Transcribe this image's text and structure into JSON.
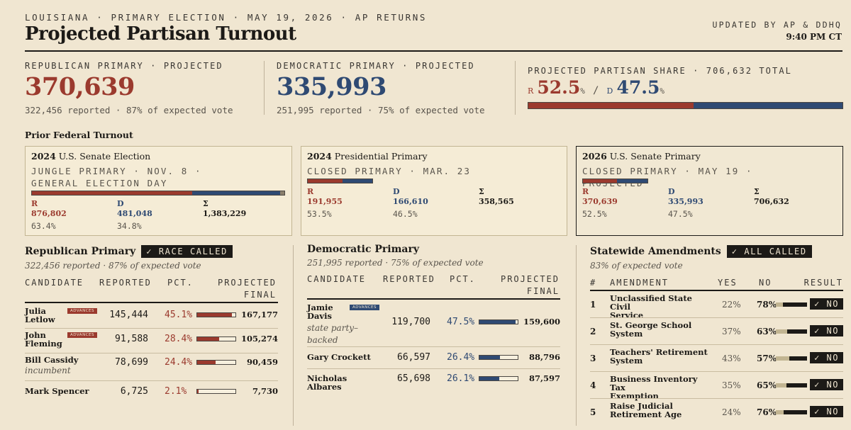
{
  "header": {
    "kicker": "LOUISIANA · PRIMARY ELECTION · MAY 19, 2026 · AP RETURNS",
    "title": "Projected Partisan Turnout",
    "updated_label": "UPDATED BY AP & DDHQ",
    "updated_time": "9:40 PM CT"
  },
  "totals": {
    "rep": {
      "label": "REPUBLICAN PRIMARY · PROJECTED",
      "value": "370,639",
      "sub": "322,456 reported · 87% of expected vote"
    },
    "dem": {
      "label": "DEMOCRATIC PRIMARY · PROJECTED",
      "value": "335,993",
      "sub": "251,995 reported · 75% of expected vote"
    },
    "share": {
      "label": "PROJECTED PARTISAN SHARE · 706,632 TOTAL",
      "r_letter": "R",
      "r_value": "52.5",
      "pct_sign": "%",
      "slash": "/",
      "d_letter": "D",
      "d_value": "47.5",
      "r_share": 52.5,
      "d_share": 47.5
    }
  },
  "colors": {
    "rep": "#9b3a2e",
    "dem": "#2f4a73",
    "other": "#8a7f6c",
    "bg": "#f0e6d1"
  },
  "prior": {
    "heading": "Prior Federal Turnout",
    "cards": [
      {
        "year": "2024",
        "name": "U.S. Senate Election",
        "sub": "JUNGLE PRIMARY · NOV. 8 · GENERAL ELECTION DAY",
        "r_val": "876,802",
        "d_val": "481,048",
        "t_val": "1,383,229",
        "r_pct": "63.4%",
        "d_pct": "34.8%",
        "r_share": 63.4,
        "d_share": 34.8,
        "o_share": 1.8
      },
      {
        "year": "2024",
        "name": "Presidential Primary",
        "sub": "CLOSED PRIMARY · MAR. 23",
        "r_val": "191,955",
        "d_val": "166,610",
        "t_val": "358,565",
        "r_pct": "53.5%",
        "d_pct": "46.5%",
        "r_share": 53.5,
        "d_share": 46.5,
        "o_share": 0
      },
      {
        "year": "2026",
        "name": "U.S. Senate Primary",
        "sub": "CLOSED PRIMARY · MAY 19 · PROJECTED",
        "r_val": "370,639",
        "d_val": "335,993",
        "t_val": "706,632",
        "r_pct": "52.5%",
        "d_pct": "47.5%",
        "r_share": 52.5,
        "d_share": 47.5,
        "o_share": 0
      }
    ],
    "r_label": "R",
    "d_label": "D",
    "t_label": "Σ"
  },
  "rep_primary": {
    "title": "Republican Primary",
    "badge": "✓ RACE CALLED",
    "sub": "322,456 reported · 87% of expected vote",
    "headers": {
      "candidate": "CANDIDATE",
      "reported": "REPORTED",
      "pct": "PCT.",
      "final_1": "PROJECTED",
      "final_2": "FINAL"
    },
    "rows": [
      {
        "name_1": "Julia",
        "name_2": "Letlow",
        "note": "",
        "advances": "ADVANCES",
        "reported": "145,444",
        "pct": "45.1%",
        "share": 45.1,
        "final": "167,177"
      },
      {
        "name_1": "John",
        "name_2": "Fleming",
        "note": "",
        "advances": "ADVANCES",
        "reported": "91,588",
        "pct": "28.4%",
        "share": 28.4,
        "final": "105,274"
      },
      {
        "name_1": "Bill Cassidy",
        "name_2": "",
        "note": "incumbent",
        "advances": "",
        "reported": "78,699",
        "pct": "24.4%",
        "share": 24.4,
        "final": "90,459"
      },
      {
        "name_1": "Mark Spencer",
        "name_2": "",
        "note": "",
        "advances": "",
        "reported": "6,725",
        "pct": "2.1%",
        "share": 2.1,
        "final": "7,730"
      }
    ]
  },
  "dem_primary": {
    "title": "Democratic Primary",
    "sub": "251,995 reported · 75% of expected vote",
    "headers": {
      "candidate": "CANDIDATE",
      "reported": "REPORTED",
      "pct": "PCT.",
      "final_1": "PROJECTED",
      "final_2": "FINAL"
    },
    "rows": [
      {
        "name_1": "Jamie",
        "name_2": "Davis",
        "note_1": "state party–",
        "note_2": "backed",
        "advances": "ADVANCES",
        "reported": "119,700",
        "pct": "47.5%",
        "share": 47.5,
        "final": "159,600"
      },
      {
        "name_1": "Gary Crockett",
        "name_2": "",
        "note_1": "",
        "note_2": "",
        "advances": "",
        "reported": "66,597",
        "pct": "26.4%",
        "share": 26.4,
        "final": "88,796"
      },
      {
        "name_1": "Nicholas Albares",
        "name_2": "",
        "note_1": "",
        "note_2": "",
        "advances": "",
        "reported": "65,698",
        "pct": "26.1%",
        "share": 26.1,
        "final": "87,597"
      }
    ]
  },
  "amendments": {
    "title": "Statewide Amendments",
    "badge": "✓ ALL CALLED",
    "sub": "83% of expected vote",
    "headers": {
      "num": "#",
      "name": "AMENDMENT",
      "yes": "YES",
      "no": "NO",
      "result": "RESULT"
    },
    "rows": [
      {
        "num": "1",
        "name_1": "Unclassified State Civil",
        "name_2": "Service",
        "yes": "22%",
        "no": "78%",
        "no_share": 78,
        "result": "✓ NO"
      },
      {
        "num": "2",
        "name_1": "St. George School",
        "name_2": "System",
        "yes": "37%",
        "no": "63%",
        "no_share": 63,
        "result": "✓ NO"
      },
      {
        "num": "3",
        "name_1": "Teachers' Retirement",
        "name_2": "System",
        "yes": "43%",
        "no": "57%",
        "no_share": 57,
        "result": "✓ NO"
      },
      {
        "num": "4",
        "name_1": "Business Inventory Tax",
        "name_2": "Exemption",
        "yes": "35%",
        "no": "65%",
        "no_share": 65,
        "result": "✓ NO"
      },
      {
        "num": "5",
        "name_1": "Raise Judicial",
        "name_2": "Retirement Age",
        "yes": "24%",
        "no": "76%",
        "no_share": 76,
        "result": "✓ NO"
      }
    ]
  }
}
